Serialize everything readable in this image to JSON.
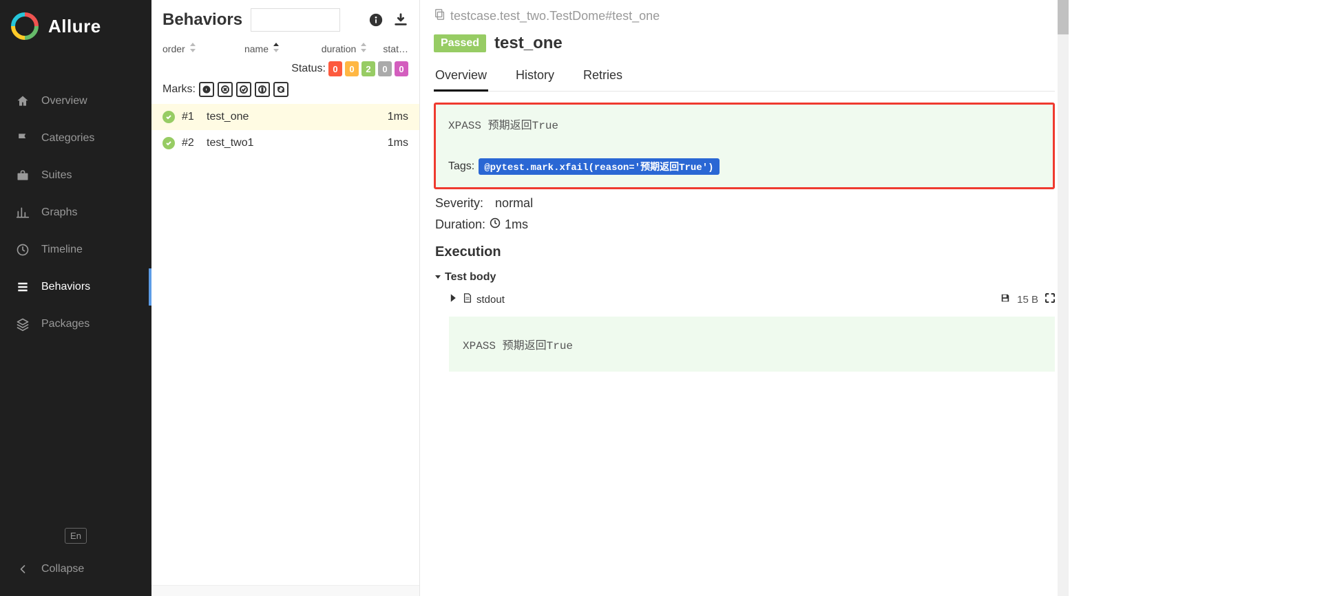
{
  "brand": {
    "title": "Allure"
  },
  "nav": {
    "overview": "Overview",
    "categories": "Categories",
    "suites": "Suites",
    "graphs": "Graphs",
    "timeline": "Timeline",
    "behaviors": "Behaviors",
    "packages": "Packages",
    "lang": "En",
    "collapse": "Collapse"
  },
  "mid": {
    "title": "Behaviors",
    "cols": {
      "order": "order",
      "name": "name",
      "duration": "duration",
      "status": "stat…"
    },
    "status_label": "Status:",
    "status_counts": {
      "failed": "0",
      "broken": "0",
      "passed": "2",
      "skipped": "0",
      "unknown": "0"
    },
    "marks_label": "Marks:",
    "tests": [
      {
        "num": "#1",
        "name": "test_one",
        "dur": "1ms",
        "selected": true
      },
      {
        "num": "#2",
        "name": "test_two1",
        "dur": "1ms",
        "selected": false
      }
    ]
  },
  "detail": {
    "crumb": "testcase.test_two.TestDome#test_one",
    "badge": "Passed",
    "title": "test_one",
    "tabs": {
      "overview": "Overview",
      "history": "History",
      "retries": "Retries"
    },
    "msg": "XPASS 预期返回True",
    "tags_label": "Tags:",
    "tag": "@pytest.mark.xfail(reason='预期返回True')",
    "severity_label": "Severity:",
    "severity": "normal",
    "duration_label": "Duration:",
    "duration": "1ms",
    "exec": "Execution",
    "body": "Test body",
    "stdout": "stdout",
    "size": "15 B",
    "code": "XPASS 预期返回True"
  }
}
